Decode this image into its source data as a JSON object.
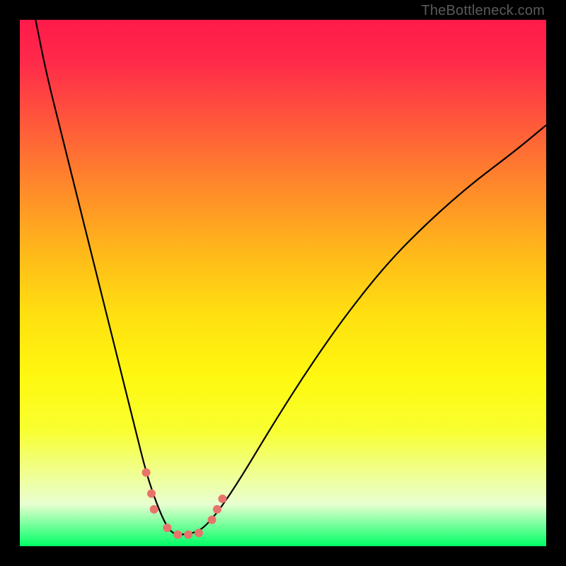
{
  "watermark": "TheBottleneck.com",
  "chart_data": {
    "type": "line",
    "title": "",
    "xlabel": "",
    "ylabel": "",
    "xlim": [
      0,
      100
    ],
    "ylim": [
      0,
      100
    ],
    "series": [
      {
        "name": "curve",
        "x": [
          3,
          5,
          8,
          12,
          16,
          20,
          22,
          24,
          26,
          28,
          29.5,
          31,
          33,
          35,
          38,
          42,
          48,
          55,
          62,
          70,
          78,
          86,
          94,
          100
        ],
        "y": [
          100,
          90,
          78,
          62,
          46,
          30,
          22,
          14,
          8,
          3.5,
          2.2,
          2.2,
          2.5,
          3.5,
          7,
          13,
          23,
          34,
          44,
          54,
          62,
          69,
          75,
          80
        ]
      }
    ],
    "markers": [
      {
        "x": 24,
        "y": 14,
        "r": 6
      },
      {
        "x": 25,
        "y": 10,
        "r": 6
      },
      {
        "x": 25.5,
        "y": 7,
        "r": 6
      },
      {
        "x": 28,
        "y": 3.5,
        "r": 6
      },
      {
        "x": 30,
        "y": 2.2,
        "r": 6
      },
      {
        "x": 32,
        "y": 2.2,
        "r": 6
      },
      {
        "x": 34,
        "y": 2.5,
        "r": 6
      },
      {
        "x": 36.5,
        "y": 5,
        "r": 6
      },
      {
        "x": 37.5,
        "y": 7,
        "r": 6
      },
      {
        "x": 38.5,
        "y": 9,
        "r": 6
      }
    ],
    "background_gradient": {
      "top": "#ff1a4a",
      "mid": "#fff810",
      "bottom": "#00ff66"
    }
  }
}
